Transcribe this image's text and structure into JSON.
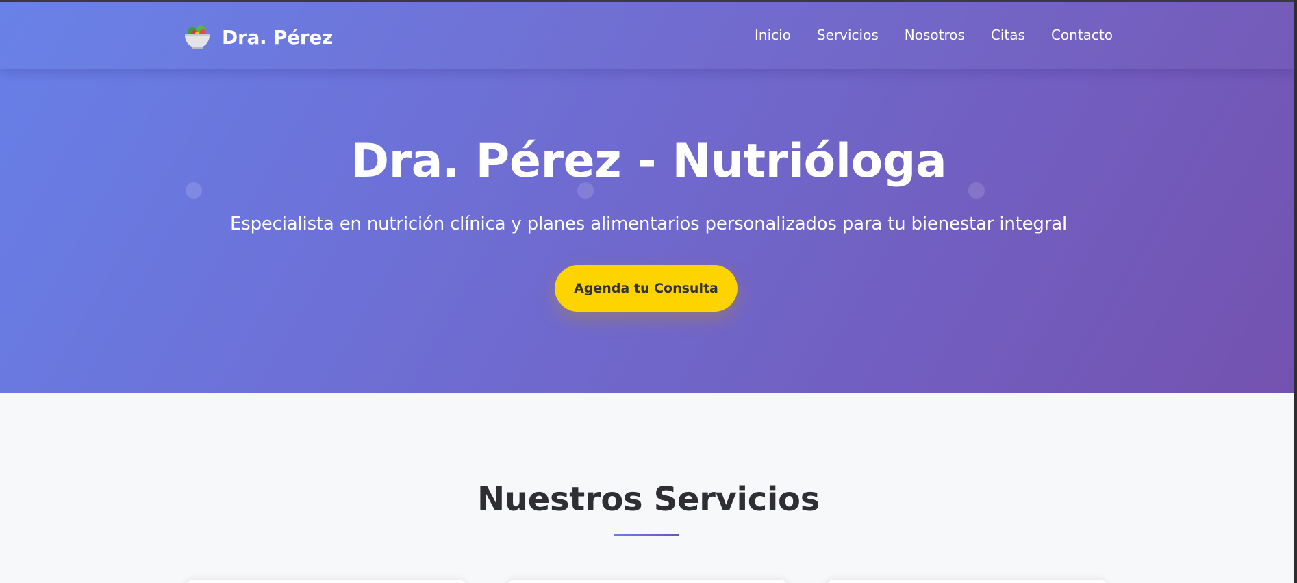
{
  "navbar": {
    "brand_name": "Dra. Pérez",
    "brand_icon": "salad-bowl-icon",
    "links": [
      {
        "label": "Inicio"
      },
      {
        "label": "Servicios"
      },
      {
        "label": "Nosotros"
      },
      {
        "label": "Citas"
      },
      {
        "label": "Contacto"
      }
    ]
  },
  "hero": {
    "title": "Dra. Pérez - Nutrióloga",
    "subtitle": "Especialista en nutrición clínica y planes alimentarios personalizados para tu bienestar integral",
    "cta_label": "Agenda tu Consulta"
  },
  "services": {
    "title": "Nuestros Servicios"
  },
  "colors": {
    "gradient_start": "#6780e8",
    "gradient_end": "#7452b0",
    "cta": "#fdd400",
    "heading": "#2f2f33",
    "section_bg": "#f7f8fa"
  }
}
